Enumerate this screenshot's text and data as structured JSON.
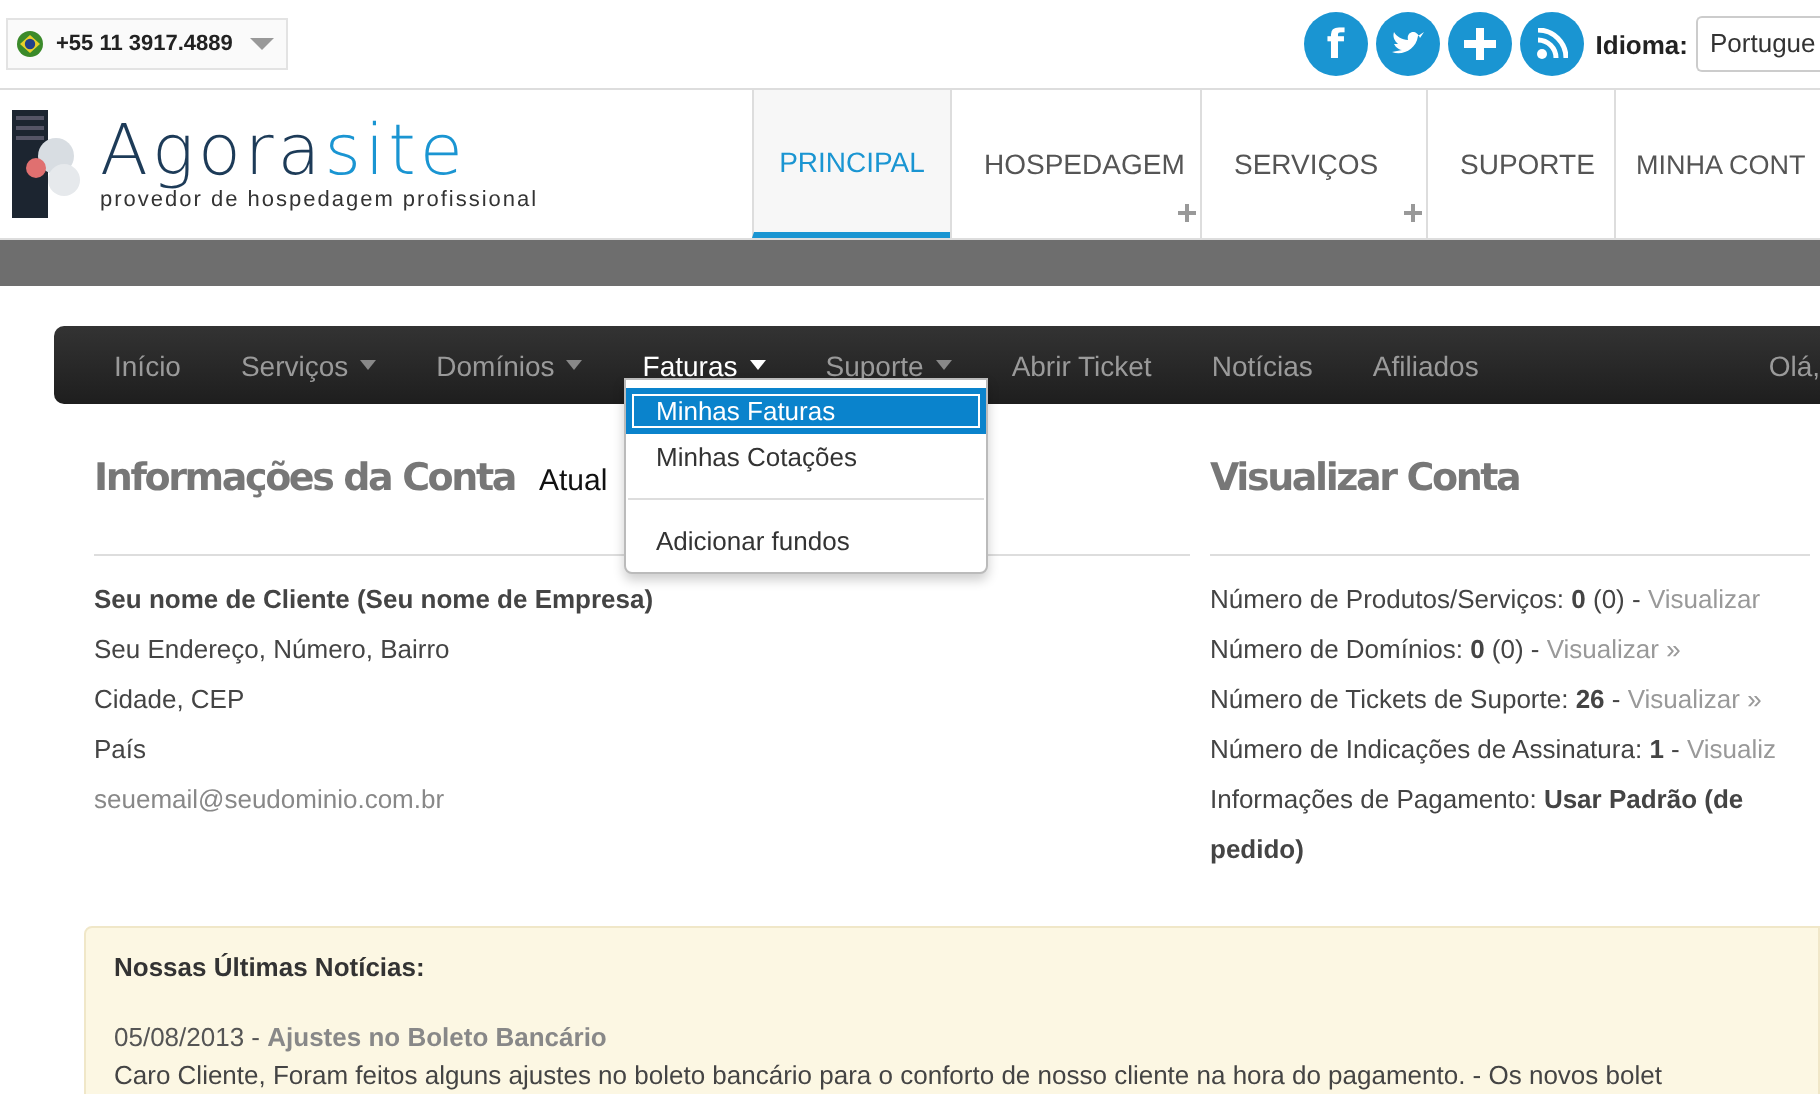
{
  "topbar": {
    "phone": "+55 11 3917.4889",
    "social": [
      {
        "kind": "facebook",
        "label": "f"
      },
      {
        "kind": "twitter"
      },
      {
        "kind": "plus"
      },
      {
        "kind": "rss"
      }
    ],
    "language_label": "Idioma:",
    "language_value": "Portugue"
  },
  "logo": {
    "name_part_1": "Agora",
    "name_part_2": "site",
    "tagline": "provedor de hospedagem profissional"
  },
  "main_menu": [
    {
      "label": "PRINCIPAL",
      "selected": true,
      "has_submenu": false
    },
    {
      "label": "HOSPEDAGEM",
      "selected": false,
      "has_submenu": true
    },
    {
      "label": "SERVIÇOS",
      "selected": false,
      "has_submenu": true
    },
    {
      "label": "SUPORTE",
      "selected": false,
      "has_submenu": false
    },
    {
      "label": "MINHA CONT",
      "selected": false,
      "has_submenu": false
    }
  ],
  "navbar": {
    "items": [
      {
        "label": "Início",
        "caret": false,
        "open": false
      },
      {
        "label": "Serviços",
        "caret": true,
        "open": false
      },
      {
        "label": "Domínios",
        "caret": true,
        "open": false
      },
      {
        "label": "Faturas",
        "caret": true,
        "open": true
      },
      {
        "label": "Suporte",
        "caret": true,
        "open": false
      },
      {
        "label": "Abrir Ticket",
        "caret": false,
        "open": false
      },
      {
        "label": "Notícias",
        "caret": false,
        "open": false
      },
      {
        "label": "Afiliados",
        "caret": false,
        "open": false
      }
    ],
    "greeting": "Olá,"
  },
  "dropdown": [
    {
      "label": "Minhas Faturas",
      "selected": true,
      "divider_before": false
    },
    {
      "label": "Minhas Cotações",
      "selected": false,
      "divider_before": false
    },
    {
      "label": "Adicionar fundos",
      "selected": false,
      "divider_before": true
    }
  ],
  "account": {
    "title": "Informações da Conta",
    "update_link": "Atual",
    "lines": [
      {
        "kind": "bold",
        "text": "Seu nome de Cliente (Seu nome de Empresa)"
      },
      {
        "kind": "plain",
        "text": "Seu Endereço, Número, Bairro"
      },
      {
        "kind": "plain",
        "text": "Cidade, CEP"
      },
      {
        "kind": "plain",
        "text": "País"
      },
      {
        "kind": "muted",
        "text": "seuemail@seudominio.com.br"
      }
    ]
  },
  "overview": {
    "title": "Visualizar Conta",
    "lines": [
      {
        "text": "Número de Produtos/Serviços: **0** (0) - ",
        "link": "Visualizar"
      },
      {
        "text": "Número de Domínios: **0** (0) - ",
        "link": "Visualizar »"
      },
      {
        "text": "Número de Tickets de Suporte: **26** - ",
        "link": "Visualizar »"
      },
      {
        "text": "Número de Indicações de Assinatura: **1** - ",
        "link": "Visualiz"
      },
      {
        "text": "Informações de Pagamento: **Usar Padrão (de**"
      }
    ],
    "continuation": "pedido)"
  },
  "news": {
    "title": "Nossas Últimas Notícias:",
    "items": [
      {
        "date": "05/08/2013 - ",
        "headline": "Ajustes no Boleto Bancário",
        "body": "Caro Cliente, Foram feitos alguns ajustes no boleto bancário para o conforto de nosso cliente na hora do pagamento. - Os novos bolet"
      }
    ]
  }
}
